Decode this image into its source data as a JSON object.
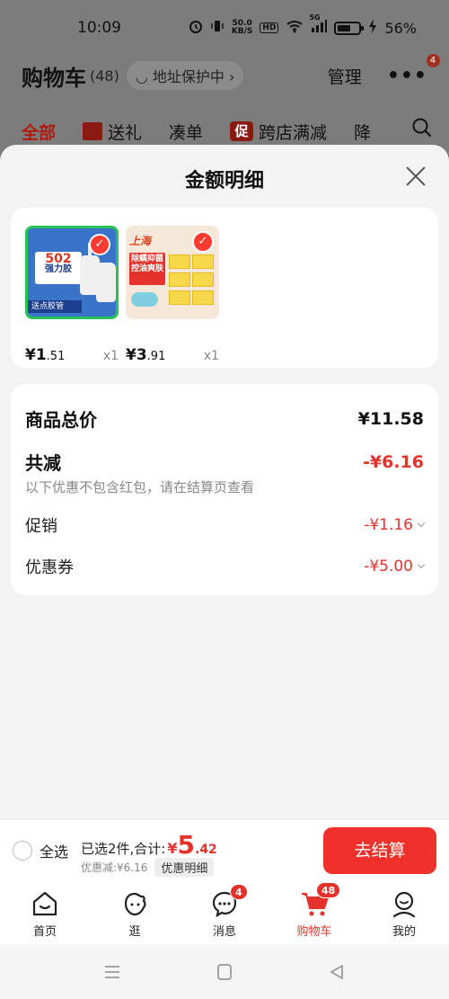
{
  "status_bar": {
    "time": "10:09",
    "net_speed_value": "50.0",
    "net_speed_unit": "KB/S",
    "hd_label": "HD",
    "signal_label": "5G",
    "battery_percent": "56%"
  },
  "cart_header": {
    "title": "购物车",
    "count": "(48)",
    "address_protect": "地址保护中",
    "manage_label": "管理",
    "more_badge": "4"
  },
  "cart_tabs": [
    {
      "label": "全部"
    },
    {
      "label": "送礼"
    },
    {
      "label": "凑单"
    },
    {
      "label": "跨店满减",
      "promo_tag": "促"
    },
    {
      "label": "降"
    }
  ],
  "sheet": {
    "title": "金额明细",
    "products": [
      {
        "name_icon": "glue-product-image",
        "price_yen": "¥1",
        "price_decimal": ".51",
        "qty": "x1",
        "image_text": {
          "label": "502",
          "sub": "强力胶",
          "strip": "送点胶管"
        }
      },
      {
        "name_icon": "soap-product-image",
        "price_yen": "¥3",
        "price_decimal": ".91",
        "qty": "x1",
        "image_text": {
          "top": "上海",
          "banner": "除螨抑菌控油爽肤"
        }
      }
    ],
    "summary": {
      "total_label": "商品总价",
      "total_value": "¥11.58",
      "discount_label": "共减",
      "discount_value": "-¥6.16",
      "note": "以下优惠不包含红包，请在结算页查看",
      "promo_label": "促销",
      "promo_value": "-¥1.16",
      "coupon_label": "优惠券",
      "coupon_value": "-¥5.00"
    }
  },
  "checkout": {
    "select_all_label": "全选",
    "selected_text": "已选2件,合计:",
    "total_yen": "¥",
    "total_int": "5",
    "total_dec": ".42",
    "discount_text": "优惠减:¥6.16",
    "detail_label": "优惠明细",
    "button_label": "去结算"
  },
  "bottom_nav": [
    {
      "label": "首页",
      "icon": "home-icon"
    },
    {
      "label": "逛",
      "icon": "browse-icon"
    },
    {
      "label": "消息",
      "icon": "message-icon",
      "badge": "4"
    },
    {
      "label": "购物车",
      "icon": "cart-icon",
      "badge": "48",
      "active": true
    },
    {
      "label": "我的",
      "icon": "profile-icon"
    }
  ],
  "colors": {
    "accent_red": "#e5322d",
    "checkout_button": "#f0302a",
    "sheet_bg": "#f3f3f3"
  }
}
